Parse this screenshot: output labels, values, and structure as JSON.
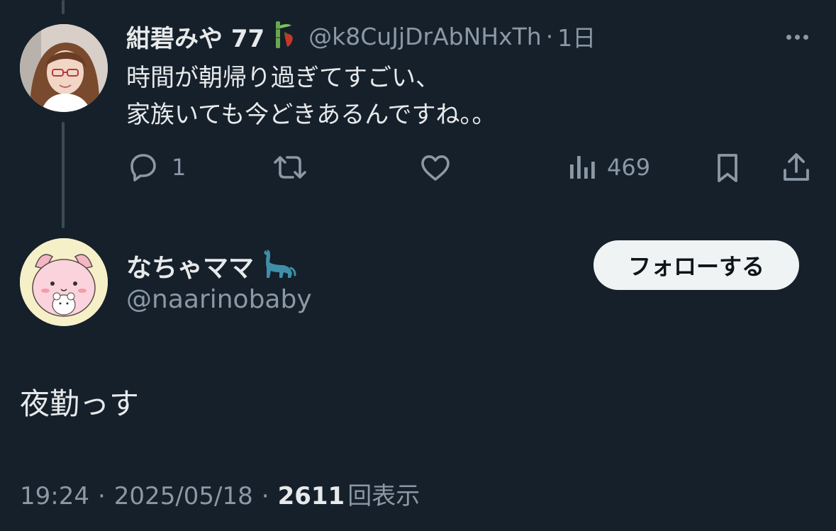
{
  "parent_tweet": {
    "display_name": "紺碧みや 77",
    "name_emoji": "bamboo-chili-icon",
    "handle": "@k8CuJjDrAbNHxTh",
    "separator": "·",
    "time": "1日",
    "text_line1": "時間が朝帰り過ぎてすごい、",
    "text_line2": "家族いても今どきあるんですね。。",
    "replies": "1",
    "retweets": "",
    "likes": "",
    "views": "469"
  },
  "main_tweet": {
    "display_name": "なちゃママ",
    "name_emoji": "sauropod-icon",
    "handle": "@naarinobaby",
    "follow_label": "フォローする",
    "text": "夜勤っす",
    "time": "19:24",
    "date": "2025/05/18",
    "separator": "·",
    "views": "2611",
    "views_label": "回表示"
  },
  "colors": {
    "background": "#15202b",
    "text_primary": "#e7e9ea",
    "text_secondary": "#8b98a5",
    "thread_line": "#3c4a56",
    "button_bg": "#eff3f4"
  }
}
